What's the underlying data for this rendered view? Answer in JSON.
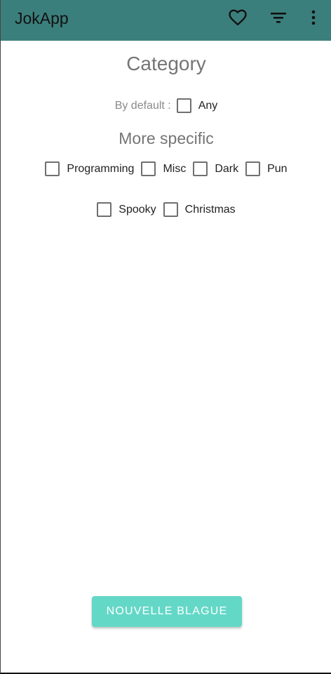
{
  "appbar": {
    "title": "JokApp",
    "background": "#3b7f7c",
    "icons": [
      "heart-outline-icon",
      "filter-icon",
      "more-vert-icon"
    ]
  },
  "category": {
    "title": "Category",
    "default_label": "By default :",
    "any_label": "Any",
    "any_checked": false
  },
  "specific": {
    "title": "More specific",
    "options": [
      {
        "label": "Programming",
        "checked": false
      },
      {
        "label": "Misc",
        "checked": false
      },
      {
        "label": "Dark",
        "checked": false
      },
      {
        "label": "Pun",
        "checked": false
      },
      {
        "label": "Spooky",
        "checked": false
      },
      {
        "label": "Christmas",
        "checked": false
      }
    ]
  },
  "actions": {
    "new_joke_label": "NOUVELLE BLAGUE",
    "new_joke_color": "#64d8c7"
  }
}
